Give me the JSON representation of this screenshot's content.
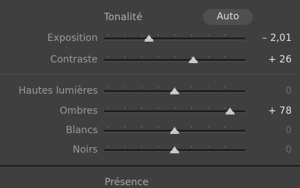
{
  "header": {
    "title": "Tonalité",
    "auto_label": "Auto"
  },
  "sliders": [
    {
      "label": "Exposition",
      "value_text": "– 2,01",
      "position": 0.32,
      "dim": false
    },
    {
      "label": "Contraste",
      "value_text": "+ 26",
      "position": 0.63,
      "dim": false
    },
    {
      "label": "Hautes lumières",
      "value_text": "0",
      "position": 0.5,
      "dim": true
    },
    {
      "label": "Ombres",
      "value_text": "+ 78",
      "position": 0.89,
      "dim": false
    },
    {
      "label": "Blancs",
      "value_text": "0",
      "position": 0.5,
      "dim": true
    },
    {
      "label": "Noirs",
      "value_text": "0",
      "position": 0.5,
      "dim": true
    }
  ],
  "footer": {
    "section_title": "Présence"
  }
}
